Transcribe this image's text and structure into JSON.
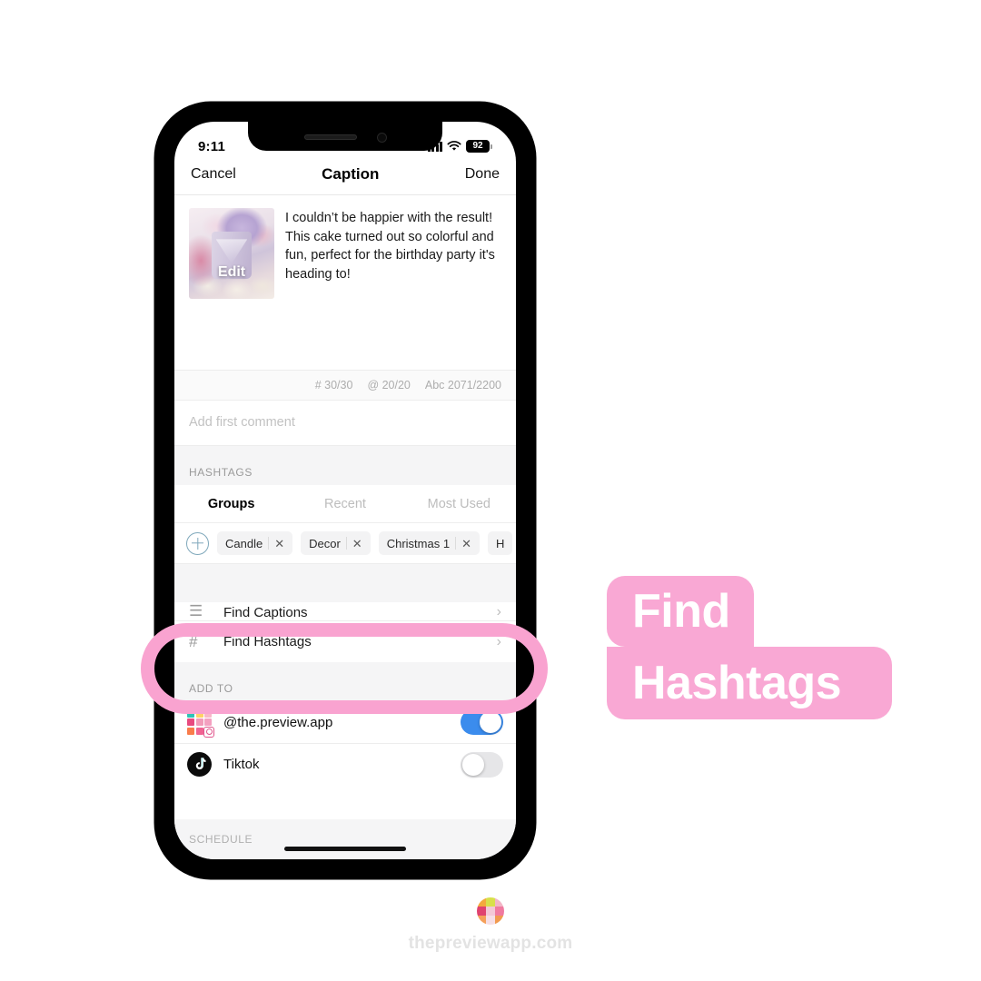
{
  "status_bar": {
    "time": "9:11",
    "battery_percent": "92",
    "wifi_icon": "wifi-icon",
    "signal_icon": "cellular-signal-icon"
  },
  "nav": {
    "cancel_label": "Cancel",
    "title": "Caption",
    "done_label": "Done"
  },
  "caption": {
    "text": "I couldn’t be happier with the result! This cake turned out so colorful and fun, perfect for the birthday party it's heading to!",
    "thumbnail_edit_label": "Edit",
    "thumbnail_icon": "post-thumbnail"
  },
  "counters": {
    "hashtags": "# 30/30",
    "mentions": "@ 20/20",
    "characters": "Abc 2071/2200"
  },
  "comment": {
    "placeholder": "Add first comment"
  },
  "hashtags_section": {
    "header": "HASHTAGS",
    "tabs": [
      {
        "label": "Groups",
        "active": true
      },
      {
        "label": "Recent",
        "active": false
      },
      {
        "label": "Most Used",
        "active": false
      }
    ],
    "add_icon": "plus-circle-icon",
    "chips": [
      {
        "label": "Candle",
        "remove_icon": "close-icon"
      },
      {
        "label": "Decor",
        "remove_icon": "close-icon"
      },
      {
        "label": "Christmas 1",
        "remove_icon": "close-icon"
      },
      {
        "label": "H",
        "remove_icon": "close-icon"
      }
    ]
  },
  "menu": {
    "rows": [
      {
        "label": "Find Captions",
        "icon": "list-icon",
        "chevron": "›",
        "partial": true
      },
      {
        "label": "Find Hashtags",
        "icon": "hashtag-icon",
        "chevron": "›",
        "partial": false
      }
    ]
  },
  "add_to": {
    "header": "ADD TO",
    "accounts": [
      {
        "name": "@the.preview.app",
        "icon": "instagram-grid-icon",
        "toggle_on": true
      },
      {
        "name": "Tiktok",
        "icon": "tiktok-icon",
        "toggle_on": false
      }
    ]
  },
  "schedule": {
    "header": "SCHEDULE"
  },
  "callout": {
    "line1": "Find",
    "line2": "Hashtags",
    "color": "#f9a8d4"
  },
  "highlight": {
    "color": "#f9a3d0"
  },
  "footer": {
    "url": "thepreviewapp.com",
    "logo_icon": "preview-app-logo"
  },
  "colors": {
    "toggle_on": "#3b8ced",
    "toggle_off": "#e6e6e8",
    "accent_pink": "#f9a8d4",
    "plus_blue": "#7fa8bb"
  }
}
